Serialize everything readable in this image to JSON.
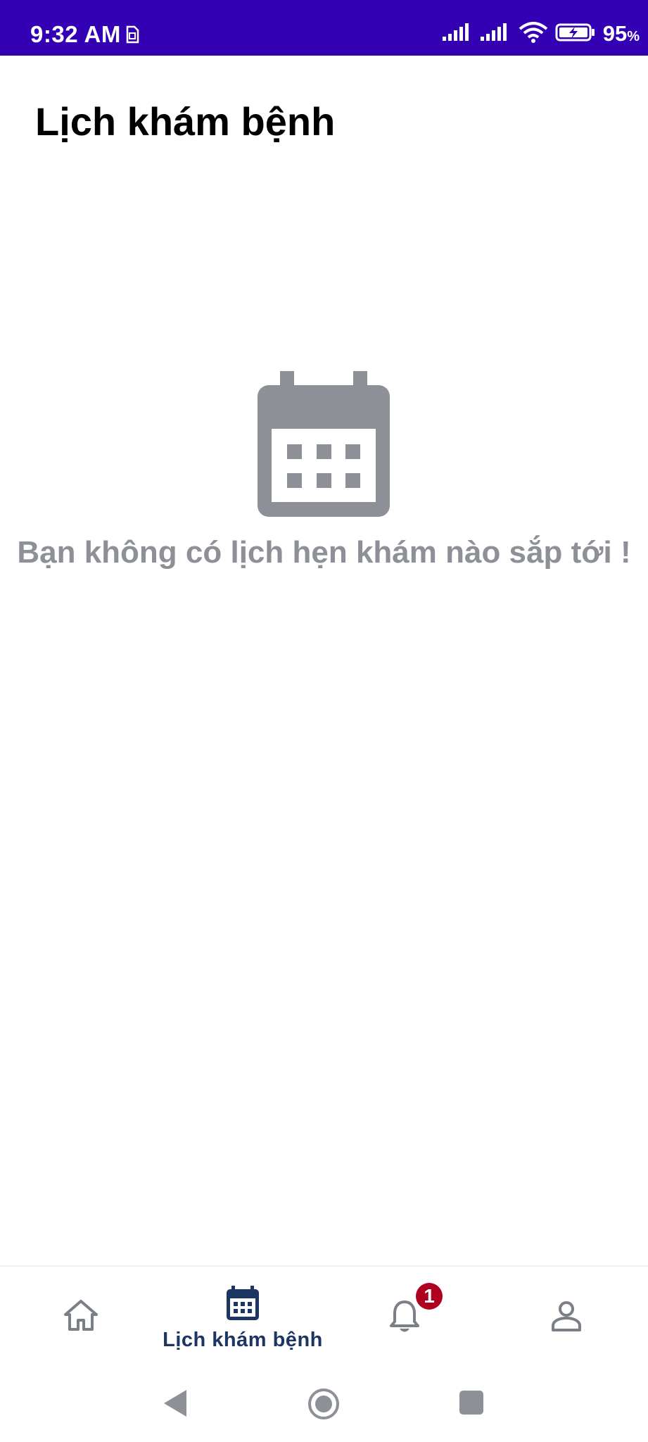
{
  "status_bar": {
    "time": "9:32 AM",
    "battery_percent": "95",
    "battery_unit": "%",
    "background_color": "#3300b3"
  },
  "page": {
    "title": "Lịch khám bệnh"
  },
  "empty_state": {
    "icon": "calendar-icon",
    "message": "Bạn không có lịch hẹn khám nào sắp tới !",
    "icon_color": "#8e9097"
  },
  "bottom_nav": {
    "items": [
      {
        "id": "home",
        "icon": "home-icon",
        "label": "",
        "active": false
      },
      {
        "id": "appointments",
        "icon": "calendar-icon",
        "label": "Lịch khám bệnh",
        "active": true
      },
      {
        "id": "notifications",
        "icon": "bell-icon",
        "label": "",
        "active": false,
        "badge": "1"
      },
      {
        "id": "profile",
        "icon": "person-icon",
        "label": "",
        "active": false
      }
    ],
    "active_color": "#1c3562",
    "inactive_color": "#7b7f86",
    "badge_color": "#b00020"
  },
  "system_nav": {
    "buttons": [
      "back-icon",
      "home-circle-icon",
      "recents-icon"
    ]
  }
}
